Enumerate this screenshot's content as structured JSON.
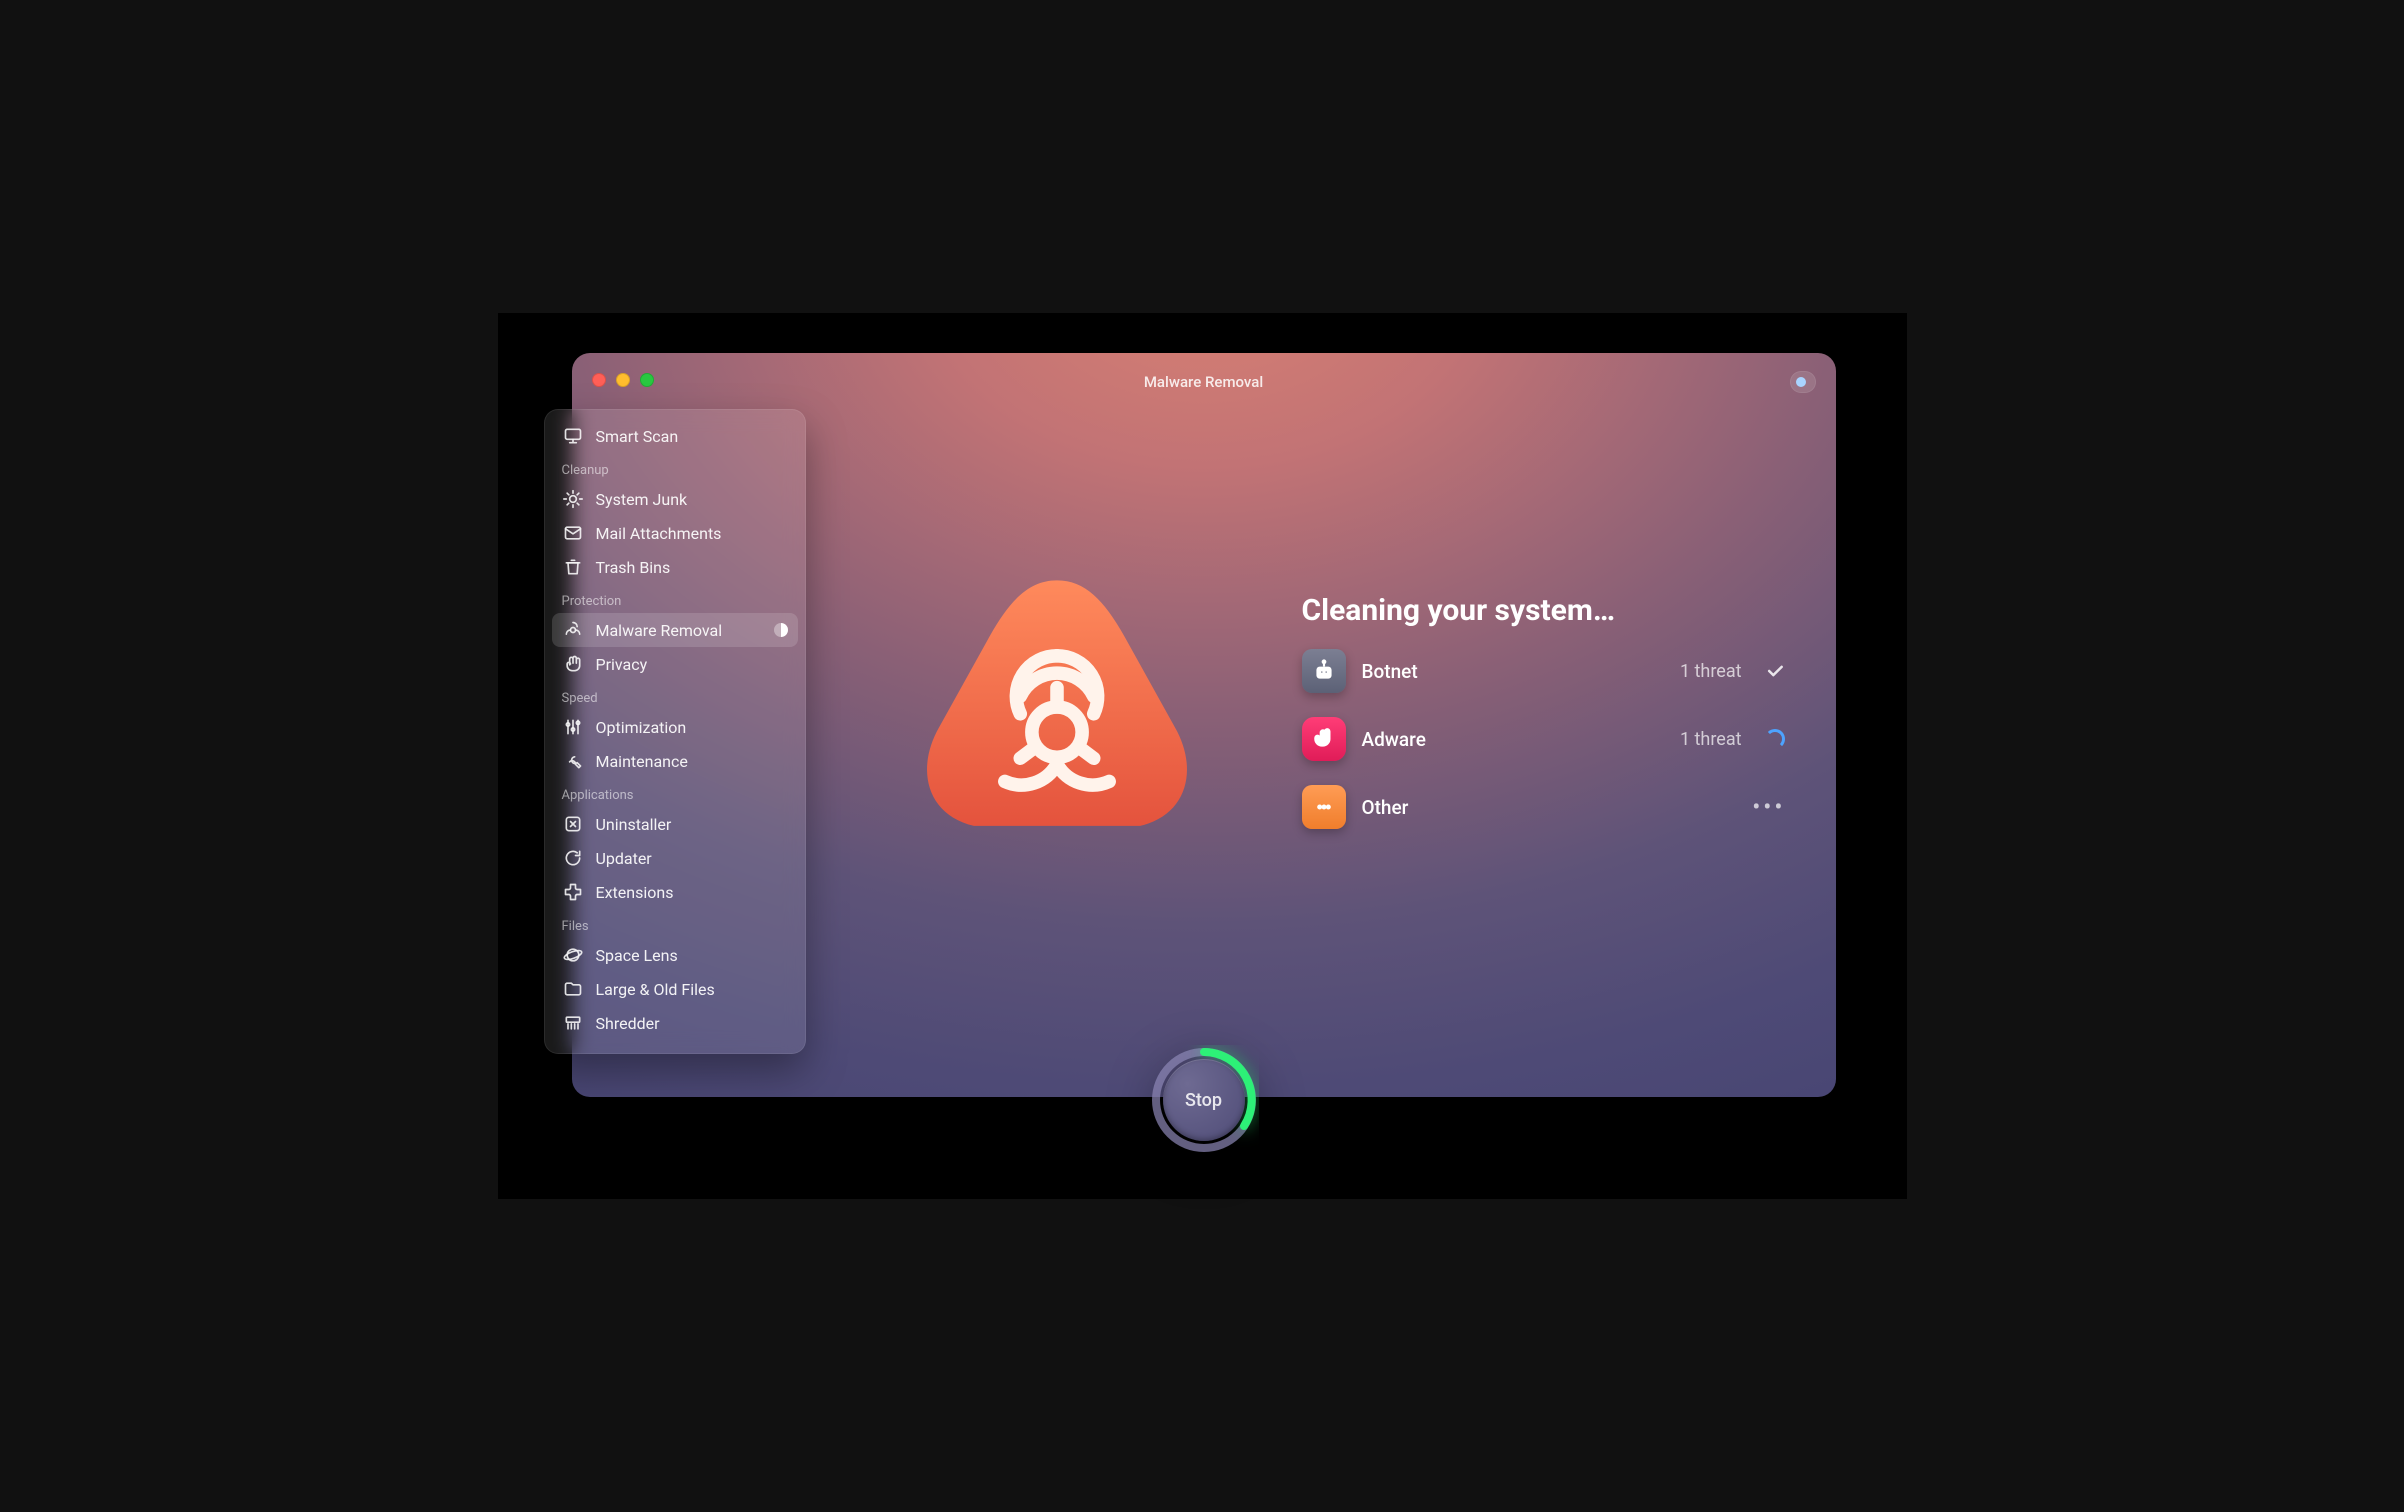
{
  "header": {
    "title": "Malware Removal"
  },
  "sidebar": {
    "top": {
      "label": "Smart Scan"
    },
    "sections": [
      {
        "title": "Cleanup",
        "items": [
          {
            "label": "System Junk"
          },
          {
            "label": "Mail Attachments"
          },
          {
            "label": "Trash Bins"
          }
        ]
      },
      {
        "title": "Protection",
        "items": [
          {
            "label": "Malware Removal",
            "active": true
          },
          {
            "label": "Privacy"
          }
        ]
      },
      {
        "title": "Speed",
        "items": [
          {
            "label": "Optimization"
          },
          {
            "label": "Maintenance"
          }
        ]
      },
      {
        "title": "Applications",
        "items": [
          {
            "label": "Uninstaller"
          },
          {
            "label": "Updater"
          },
          {
            "label": "Extensions"
          }
        ]
      },
      {
        "title": "Files",
        "items": [
          {
            "label": "Space Lens"
          },
          {
            "label": "Large & Old Files"
          },
          {
            "label": "Shredder"
          }
        ]
      }
    ]
  },
  "main": {
    "heading": "Cleaning your system…",
    "threats": [
      {
        "name": "Botnet",
        "count_label": "1 threat",
        "status": "done"
      },
      {
        "name": "Adware",
        "count_label": "1 threat",
        "status": "working"
      },
      {
        "name": "Other",
        "count_label": "",
        "status": "pending"
      }
    ],
    "stop_label": "Stop"
  },
  "colors": {
    "accent_green": "#2df077",
    "accent_blue": "#4da3ff"
  }
}
